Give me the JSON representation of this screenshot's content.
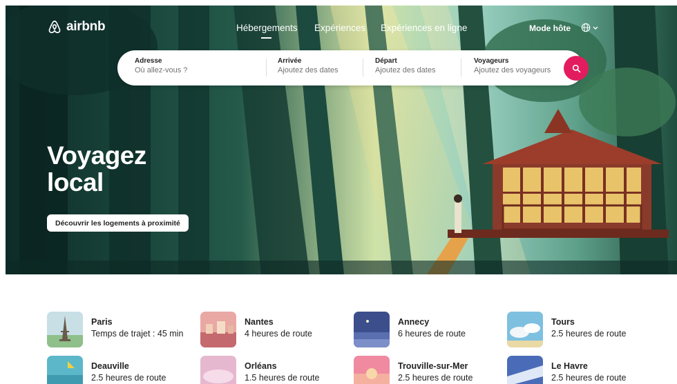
{
  "brand": {
    "name": "airbnb",
    "accent": "#e31c5f"
  },
  "nav": {
    "items": [
      "Hébergements",
      "Expériences",
      "Expériences en ligne"
    ],
    "active": "Hébergements",
    "host_label": "Mode hôte",
    "language_icon": "globe-icon"
  },
  "search": {
    "fields": [
      {
        "label": "Adresse",
        "placeholder": "Où allez-vous ?"
      },
      {
        "label": "Arrivée",
        "placeholder": "Ajoutez des dates"
      },
      {
        "label": "Départ",
        "placeholder": "Ajoutez des dates"
      },
      {
        "label": "Voyageurs",
        "placeholder": "Ajoutez des voyageurs"
      }
    ],
    "button_icon": "search-icon"
  },
  "hero": {
    "title_line1": "Voyagez",
    "title_line2": "local",
    "cta": "Découvrir les logements à proximité"
  },
  "destinations": [
    {
      "name": "Paris",
      "time": "Temps de trajet : 45 min"
    },
    {
      "name": "Nantes",
      "time": "4 heures de route"
    },
    {
      "name": "Annecy",
      "time": "6 heures de route"
    },
    {
      "name": "Tours",
      "time": "2.5 heures de route"
    },
    {
      "name": "Deauville",
      "time": "2.5 heures de route"
    },
    {
      "name": "Orléans",
      "time": "1.5 heures de route"
    },
    {
      "name": "Trouville-sur-Mer",
      "time": "2.5 heures de route"
    },
    {
      "name": "Le Havre",
      "time": "2.5 heures de route"
    }
  ]
}
